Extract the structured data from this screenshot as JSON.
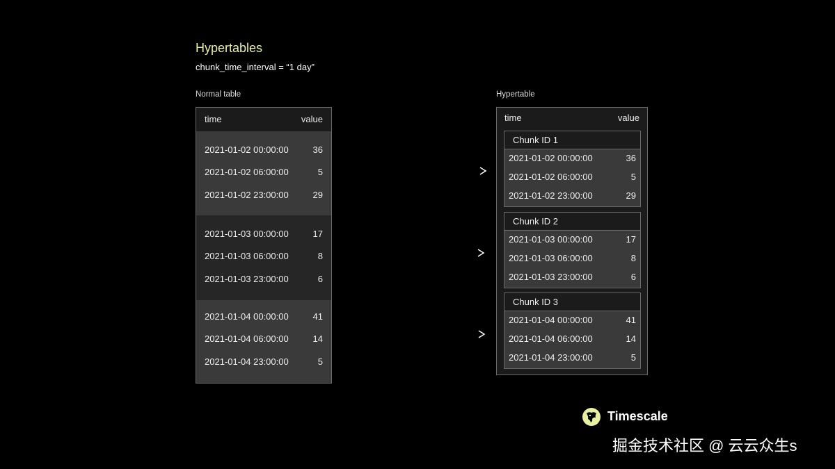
{
  "title": "Hypertables",
  "subtitle": "chunk_time_interval = “1 day”",
  "normal_table": {
    "label": "Normal table",
    "headers": {
      "time": "time",
      "value": "value"
    },
    "groups": [
      {
        "rows": [
          {
            "time": "2021-01-02 00:00:00",
            "value": "36"
          },
          {
            "time": "2021-01-02 06:00:00",
            "value": "5"
          },
          {
            "time": "2021-01-02 23:00:00",
            "value": "29"
          }
        ]
      },
      {
        "rows": [
          {
            "time": "2021-01-03 00:00:00",
            "value": "17"
          },
          {
            "time": "2021-01-03 06:00:00",
            "value": "8"
          },
          {
            "time": "2021-01-03 23:00:00",
            "value": "6"
          }
        ]
      },
      {
        "rows": [
          {
            "time": "2021-01-04 00:00:00",
            "value": "41"
          },
          {
            "time": "2021-01-04 06:00:00",
            "value": "14"
          },
          {
            "time": "2021-01-04 23:00:00",
            "value": "5"
          }
        ]
      }
    ]
  },
  "hypertable": {
    "label": "Hypertable",
    "headers": {
      "time": "time",
      "value": "value"
    },
    "chunks": [
      {
        "title": "Chunk ID 1",
        "rows": [
          {
            "time": "2021-01-02 00:00:00",
            "value": "36"
          },
          {
            "time": "2021-01-02 06:00:00",
            "value": "5"
          },
          {
            "time": "2021-01-02 23:00:00",
            "value": "29"
          }
        ]
      },
      {
        "title": "Chunk ID 2",
        "rows": [
          {
            "time": "2021-01-03 00:00:00",
            "value": "17"
          },
          {
            "time": "2021-01-03 06:00:00",
            "value": "8"
          },
          {
            "time": "2021-01-03 23:00:00",
            "value": "6"
          }
        ]
      },
      {
        "title": "Chunk ID 3",
        "rows": [
          {
            "time": "2021-01-04 00:00:00",
            "value": "41"
          },
          {
            "time": "2021-01-04 06:00:00",
            "value": "14"
          },
          {
            "time": "2021-01-04 23:00:00",
            "value": "5"
          }
        ]
      }
    ]
  },
  "brand": {
    "name": "Timescale",
    "accent": "#e8f0a0"
  },
  "watermark": "掘金技术社区 @ 云云众生s"
}
